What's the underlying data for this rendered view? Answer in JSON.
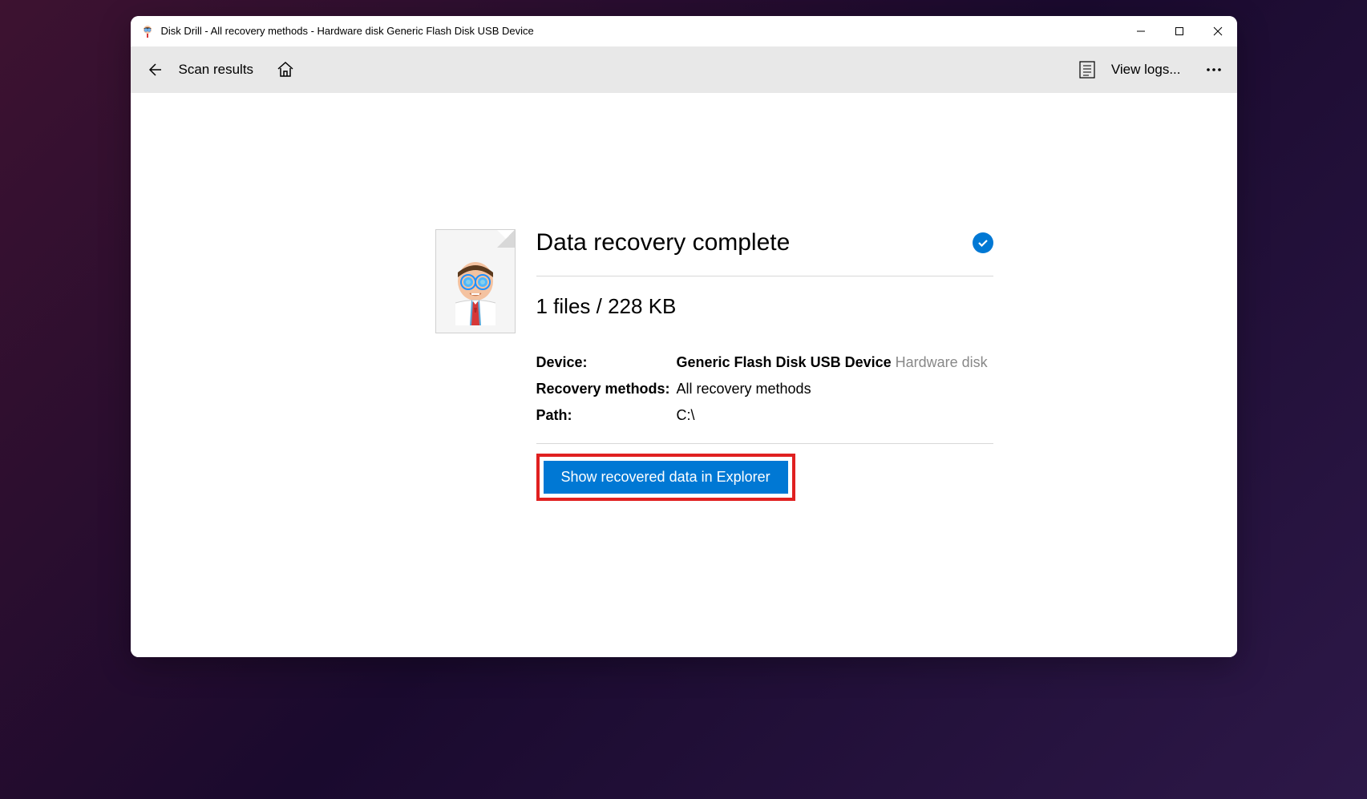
{
  "window": {
    "title": "Disk Drill - All recovery methods - Hardware disk Generic Flash Disk USB Device"
  },
  "toolbar": {
    "scan_results": "Scan results",
    "view_logs": "View logs..."
  },
  "result": {
    "title": "Data recovery complete",
    "files_info": "1 files / 228 KB",
    "device_label": "Device:",
    "device_name": "Generic Flash Disk USB Device",
    "device_type": "Hardware disk",
    "recovery_methods_label": "Recovery methods:",
    "recovery_methods_value": "All recovery methods",
    "path_label": "Path:",
    "path_value": "C:\\",
    "button_label": "Show recovered data in Explorer"
  }
}
